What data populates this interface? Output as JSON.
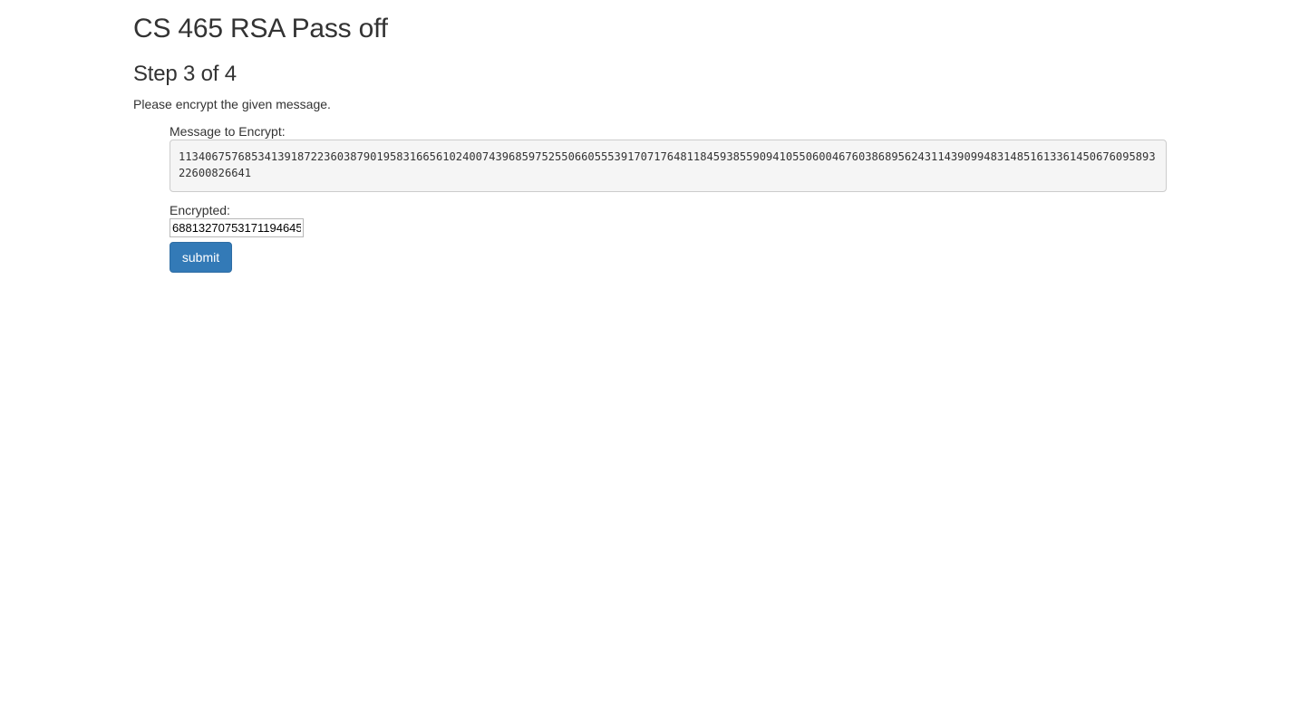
{
  "header": {
    "title": "CS 465 RSA Pass off",
    "step": "Step 3 of 4",
    "instructions": "Please encrypt the given message."
  },
  "form": {
    "message_label": "Message to Encrypt:",
    "message_value": "113406757685341391872236038790195831665610240074396859752550660555391707176481184593855909410550600467603868956243114390994831485161336145067609589322600826641",
    "encrypted_label": "Encrypted:",
    "encrypted_value": "68813270753171194645",
    "submit_label": "submit"
  },
  "colors": {
    "button_bg": "#337ab7",
    "message_bg": "#f5f5f5",
    "text": "#333333"
  }
}
